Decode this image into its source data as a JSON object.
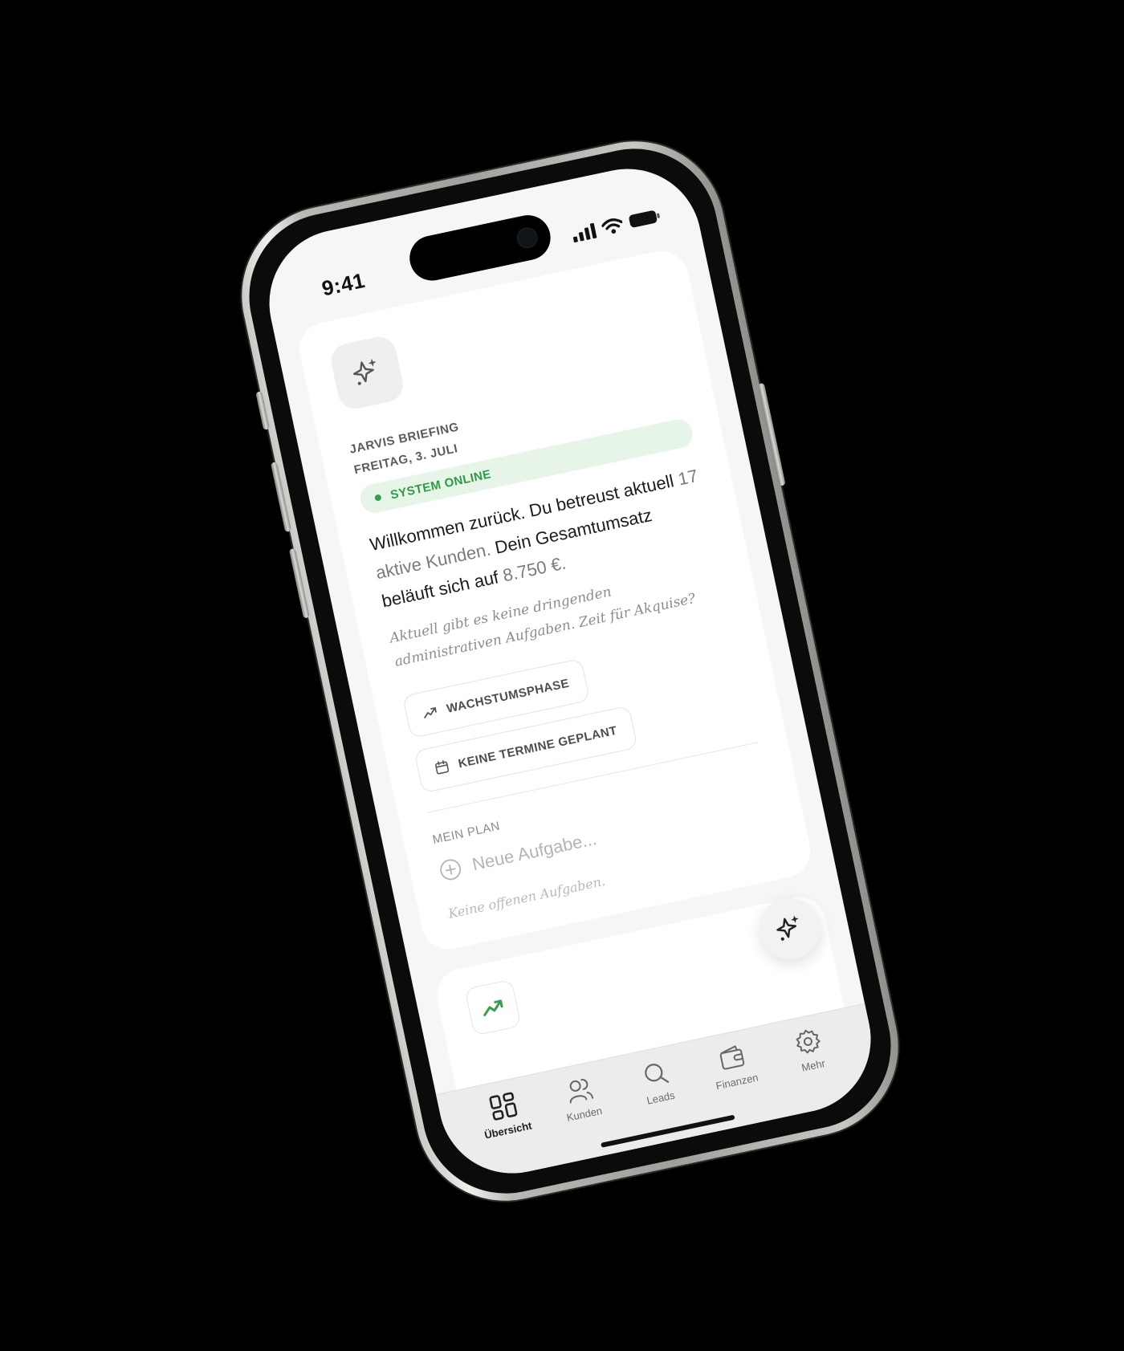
{
  "status_bar": {
    "time": "9:41"
  },
  "briefing": {
    "title": "JARVIS BRIEFING",
    "date": "FREITAG, 3. JULI",
    "status": "SYSTEM ONLINE",
    "welcome_part1": "Willkommen zurück. Du betreust aktuell",
    "active_clients": "17 aktive Kunden.",
    "welcome_part2": "Dein Gesamtumsatz beläuft sich auf",
    "revenue": "8.750 €.",
    "note": "Aktuell gibt es keine dringenden administrativen Aufgaben. Zeit für Akquise?",
    "chips": [
      {
        "label": "WACHSTUMSPHASE",
        "icon": "trending-up-icon"
      },
      {
        "label": "KEINE TERMINE GEPLANT",
        "icon": "calendar-icon"
      }
    ]
  },
  "plan": {
    "label": "MEIN PLAN",
    "new_task_placeholder": "Neue Aufgabe...",
    "empty_text": "Keine offenen Aufgaben."
  },
  "tabs": [
    {
      "label": "Übersicht",
      "icon": "grid-icon",
      "active": true
    },
    {
      "label": "Kunden",
      "icon": "users-icon",
      "active": false
    },
    {
      "label": "Leads",
      "icon": "search-icon",
      "active": false
    },
    {
      "label": "Finanzen",
      "icon": "wallet-icon",
      "active": false
    },
    {
      "label": "Mehr",
      "icon": "gear-icon",
      "active": false
    }
  ],
  "colors": {
    "accent_green": "#35a04c",
    "badge_bg": "#e7f5e9",
    "background": "#000000",
    "screen": "#f6f6f5"
  }
}
